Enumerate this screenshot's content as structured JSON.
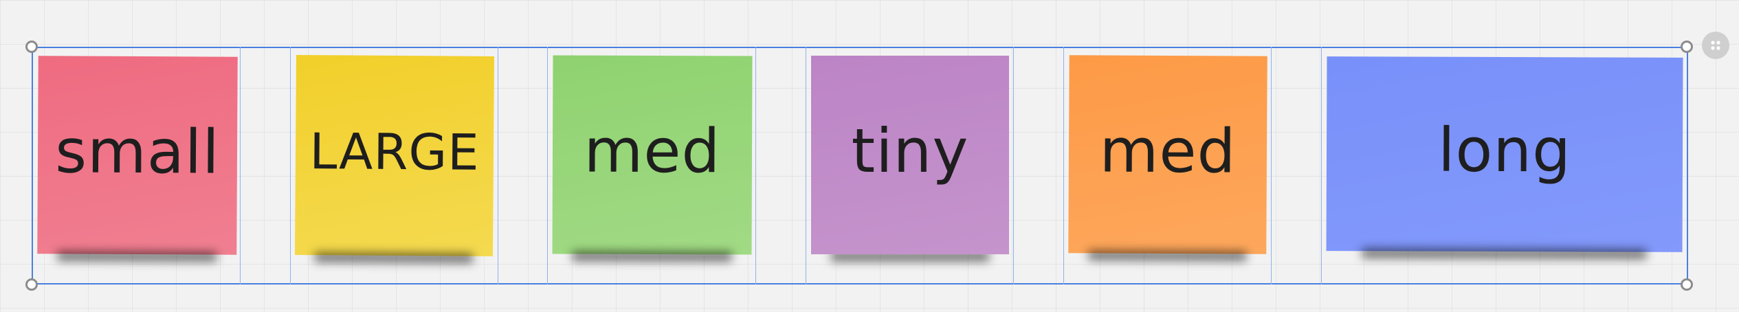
{
  "board": {
    "stickies": [
      {
        "label": "small",
        "color": "#ef6b80"
      },
      {
        "label": "LARGE",
        "color": "#f2cf2a"
      },
      {
        "label": "med",
        "color": "#8fd270"
      },
      {
        "label": "tiny",
        "color": "#bc84c6"
      },
      {
        "label": "med",
        "color": "#fd9a46"
      },
      {
        "label": "long",
        "color": "#7890fa"
      }
    ],
    "selection_color": "#4a7fe0",
    "grip_icon": "grip-dots-icon"
  }
}
